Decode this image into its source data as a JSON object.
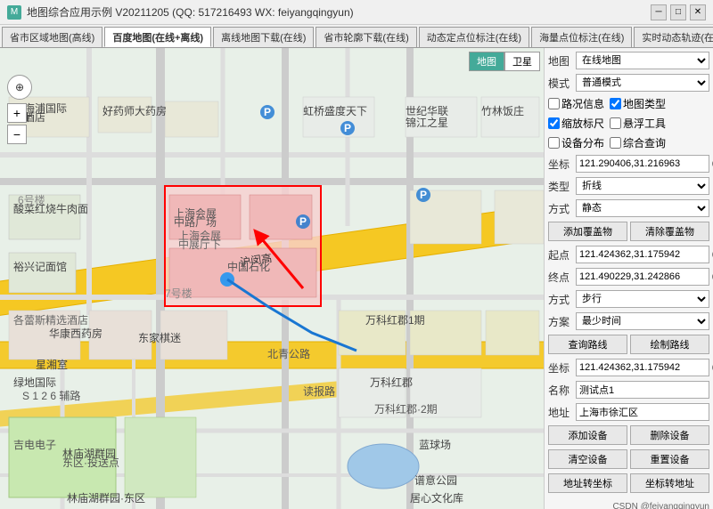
{
  "titleBar": {
    "title": "地图综合应用示例 V20211205 (QQ: 517216493 WX: feiyangqingyun)",
    "icon": "M",
    "minBtn": "─",
    "maxBtn": "□",
    "closeBtn": "✕"
  },
  "tabs": [
    {
      "label": "省市区域地图(高线)",
      "active": false
    },
    {
      "label": "百度地图(在线+离线)",
      "active": true
    },
    {
      "label": "离线地图下载(在线)",
      "active": false
    },
    {
      "label": "省市轮廓下载(在线)",
      "active": false
    },
    {
      "label": "动态定点位标注(在线)",
      "active": false
    },
    {
      "label": "海量点位标注(在线)",
      "active": false
    },
    {
      "label": "实时动态轨迹(在线)",
      "active": false
    }
  ],
  "mapToggle": {
    "mapLabel": "地图",
    "satelliteLabel": "卫星"
  },
  "zoomControls": {
    "compassSymbol": "⊕",
    "plusSymbol": "+",
    "minusSymbol": "−"
  },
  "rightPanel": {
    "mapTypeLabel": "地图",
    "mapTypeValue": "在线地图",
    "modeLabel": "模式",
    "modeValue": "普通模式",
    "checkbox1Label": "路况信息",
    "checkbox1Checked": false,
    "checkbox2Label": "地图类型",
    "checkbox2Checked": true,
    "checkbox3Label": "缩放标尺",
    "checkbox3Checked": true,
    "checkbox4Label": "悬浮工具",
    "checkbox4Checked": false,
    "checkbox5Label": "设备分布",
    "checkbox5Checked": false,
    "checkbox6Label": "综合查询",
    "checkbox6Checked": false,
    "coordLabel": "坐标",
    "coordValue": "121.290406,31.216963",
    "typeLabel": "类型",
    "typeValue": "折线",
    "methodLabel": "方式",
    "methodValue": "静态",
    "addCoverBtn": "添加覆盖物",
    "clearCoverBtn": "清除覆盖物",
    "startLabel": "起点",
    "startValue": "121.424362,31.175942",
    "endLabel": "终点",
    "endValue": "121.490229,31.242866",
    "walkLabel": "方式",
    "walkValue": "步行",
    "routeMethodLabel": "方案",
    "routeMethodValue": "最少时间",
    "queryRouteBtn": "查询路线",
    "drawRouteBtn": "绘制路线",
    "coordLabel2": "坐标",
    "coordValue2": "121.424362,31.175942",
    "nameLabel": "名称",
    "nameValue": "测试点1",
    "addressLabel": "地址",
    "addressValue": "上海市徐汇区",
    "addDevBtn": "添加设备",
    "delDevBtn": "删除设备",
    "clearDevBtn": "清空设备",
    "resetDevBtn": "重置设备",
    "coordTransBtn": "地址转坐标",
    "addrTransBtn": "坐标转地址",
    "watermark": "CSDN @feiyangqingyun"
  }
}
